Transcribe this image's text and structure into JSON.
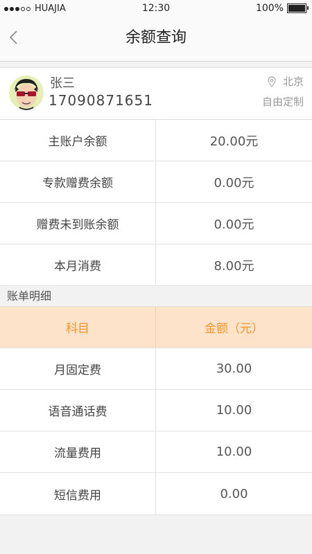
{
  "status_bar": {
    "carrier": "HUAJIA",
    "time": "12:30",
    "battery_percent": "100%",
    "battery_level": 1.0
  },
  "nav": {
    "title": "余额查询"
  },
  "profile": {
    "name": "张三",
    "phone": "17090871651",
    "location": "北京",
    "custom_label": "自由定制"
  },
  "balances": [
    {
      "label": "主账户余额",
      "value": "20.00元"
    },
    {
      "label": "专款赠费余额",
      "value": "0.00元"
    },
    {
      "label": "赠费未到账余额",
      "value": "0.00元"
    },
    {
      "label": "本月消费",
      "value": "8.00元"
    }
  ],
  "bill_detail": {
    "section_title": "账单明细",
    "headers": [
      "科目",
      "金额（元）"
    ],
    "rows": [
      {
        "item": "月固定费",
        "amount": "30.00"
      },
      {
        "item": "语音通话费",
        "amount": "10.00"
      },
      {
        "item": "流量费用",
        "amount": "10.00"
      },
      {
        "item": "短信费用",
        "amount": "0.00"
      }
    ]
  },
  "colors": {
    "header_bg": "#fde3c9",
    "header_text": "#f0962d"
  }
}
